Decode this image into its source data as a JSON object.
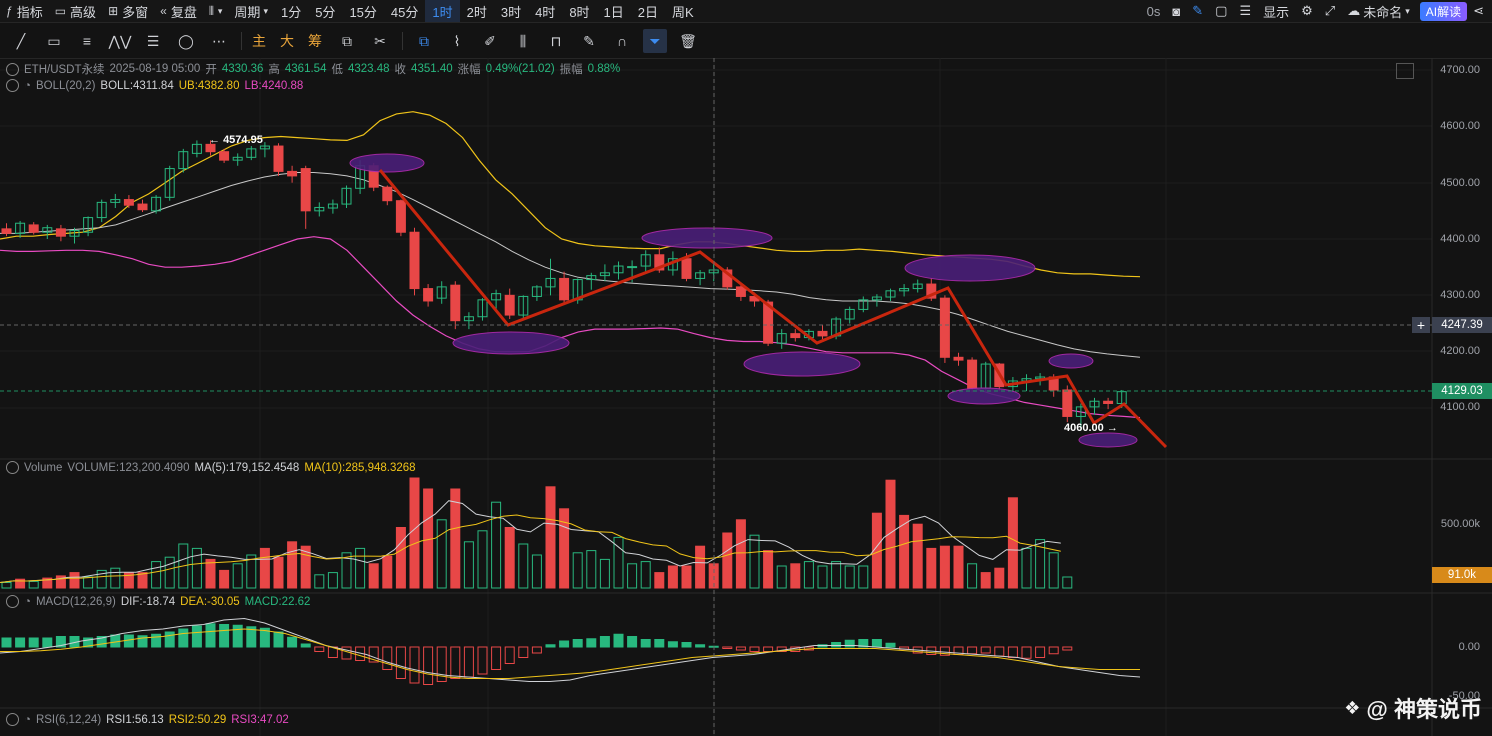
{
  "topbar": {
    "indicators": "指标",
    "advanced": "高级",
    "multi_window": "多窗",
    "replay": "复盘",
    "period": "周期",
    "timeframes": [
      "1分",
      "5分",
      "15分",
      "45分",
      "1时",
      "2时",
      "3时",
      "4时",
      "8时",
      "1日",
      "2日",
      "周K"
    ],
    "active_timeframe": "1时",
    "countdown": "0s",
    "display": "显示",
    "unnamed": "未命名",
    "ai_label": "AI解读"
  },
  "toolbar": {
    "main": "主",
    "big": "大",
    "chips": "筹"
  },
  "legend": {
    "symbol": "ETH/USDT永续",
    "datetime": "2025-08-19 05:00",
    "open_label": "开",
    "open": "4330.36",
    "high_label": "高",
    "high": "4361.54",
    "low_label": "低",
    "low": "4323.48",
    "close_label": "收",
    "close": "4351.40",
    "change_label": "涨幅",
    "change": "0.49%(21.02)",
    "amp_label": "振幅",
    "amp": "0.88%",
    "boll_name": "BOLL(20,2)",
    "boll": "BOLL:4311.84",
    "ub": "UB:4382.80",
    "lb": "LB:4240.88",
    "vol_name": "Volume",
    "volume": "VOLUME:123,200.4090",
    "ma5": "MA(5):179,152.4548",
    "ma10": "MA(10):285,948.3268",
    "macd_name": "MACD(12,26,9)",
    "dif": "DIF:-18.74",
    "dea": "DEA:-30.05",
    "macd": "MACD:22.62",
    "rsi_name": "RSI(6,12,24)",
    "rsi1": "RSI1:56.13",
    "rsi2": "RSI2:50.29",
    "rsi3": "RSI3:47.02"
  },
  "axis": {
    "price_ticks": [
      "4700.00",
      "4600.00",
      "4500.00",
      "4400.00",
      "4300.00",
      "4200.00",
      "4100.00"
    ],
    "cursor_price": "4247.39",
    "last_price": "4129.03",
    "volume_tick": "500.00k",
    "volume_last": "91.0k",
    "macd_tick_zero": "0.00",
    "macd_tick_low": "-50.00"
  },
  "annotations": {
    "high_label": "4574.95",
    "low_label": "4060.00"
  },
  "watermark": "@ 神策说币",
  "colors": {
    "up": "#28b87f",
    "down": "#e84747",
    "ub": "#f0c419",
    "mid": "#c8c8c8",
    "lb": "#e84bc2",
    "trend": "#c8260e",
    "ellipse": "#4a1f78"
  },
  "chart_data": {
    "type": "candlestick",
    "price_range": [
      4040,
      4720
    ],
    "candles_ohlc": [
      [
        4418,
        4428,
        4405,
        4410
      ],
      [
        4410,
        4432,
        4402,
        4428
      ],
      [
        4425,
        4430,
        4408,
        4412
      ],
      [
        4412,
        4425,
        4400,
        4420
      ],
      [
        4418,
        4425,
        4396,
        4405
      ],
      [
        4405,
        4420,
        4392,
        4415
      ],
      [
        4412,
        4440,
        4405,
        4438
      ],
      [
        4438,
        4470,
        4430,
        4465
      ],
      [
        4465,
        4480,
        4455,
        4470
      ],
      [
        4470,
        4478,
        4455,
        4460
      ],
      [
        4462,
        4470,
        4448,
        4452
      ],
      [
        4450,
        4478,
        4445,
        4474
      ],
      [
        4474,
        4530,
        4468,
        4525
      ],
      [
        4525,
        4560,
        4518,
        4555
      ],
      [
        4552,
        4575,
        4545,
        4568
      ],
      [
        4568,
        4575,
        4548,
        4555
      ],
      [
        4555,
        4560,
        4535,
        4540
      ],
      [
        4540,
        4552,
        4530,
        4545
      ],
      [
        4545,
        4565,
        4540,
        4560
      ],
      [
        4560,
        4572,
        4545,
        4565
      ],
      [
        4565,
        4570,
        4512,
        4520
      ],
      [
        4520,
        4530,
        4500,
        4512
      ],
      [
        4525,
        4530,
        4418,
        4450
      ],
      [
        4450,
        4465,
        4440,
        4456
      ],
      [
        4455,
        4470,
        4445,
        4462
      ],
      [
        4462,
        4495,
        4455,
        4490
      ],
      [
        4490,
        4540,
        4480,
        4530
      ],
      [
        4530,
        4535,
        4485,
        4492
      ],
      [
        4492,
        4495,
        4460,
        4468
      ],
      [
        4468,
        4470,
        4405,
        4412
      ],
      [
        4412,
        4420,
        4300,
        4312
      ],
      [
        4312,
        4320,
        4280,
        4290
      ],
      [
        4295,
        4325,
        4285,
        4315
      ],
      [
        4318,
        4325,
        4240,
        4255
      ],
      [
        4255,
        4270,
        4240,
        4262
      ],
      [
        4262,
        4295,
        4255,
        4292
      ],
      [
        4292,
        4310,
        4275,
        4303
      ],
      [
        4300,
        4312,
        4258,
        4265
      ],
      [
        4265,
        4300,
        4258,
        4298
      ],
      [
        4298,
        4318,
        4290,
        4315
      ],
      [
        4315,
        4365,
        4300,
        4330
      ],
      [
        4330,
        4342,
        4285,
        4292
      ],
      [
        4292,
        4330,
        4285,
        4328
      ],
      [
        4328,
        4340,
        4310,
        4335
      ],
      [
        4335,
        4355,
        4325,
        4340
      ],
      [
        4340,
        4360,
        4328,
        4352
      ],
      [
        4351,
        4362,
        4323,
        4351
      ],
      [
        4352,
        4380,
        4340,
        4372
      ],
      [
        4372,
        4385,
        4340,
        4345
      ],
      [
        4345,
        4378,
        4335,
        4365
      ],
      [
        4365,
        4375,
        4325,
        4330
      ],
      [
        4330,
        4345,
        4318,
        4340
      ],
      [
        4340,
        4360,
        4325,
        4345
      ],
      [
        4345,
        4350,
        4310,
        4315
      ],
      [
        4315,
        4320,
        4290,
        4298
      ],
      [
        4298,
        4305,
        4280,
        4290
      ],
      [
        4288,
        4292,
        4210,
        4215
      ],
      [
        4215,
        4240,
        4205,
        4232
      ],
      [
        4232,
        4240,
        4218,
        4225
      ],
      [
        4225,
        4240,
        4220,
        4236
      ],
      [
        4236,
        4248,
        4222,
        4228
      ],
      [
        4228,
        4262,
        4222,
        4258
      ],
      [
        4258,
        4280,
        4250,
        4275
      ],
      [
        4275,
        4298,
        4270,
        4292
      ],
      [
        4292,
        4302,
        4280,
        4297
      ],
      [
        4297,
        4312,
        4290,
        4308
      ],
      [
        4308,
        4320,
        4298,
        4312
      ],
      [
        4312,
        4328,
        4305,
        4320
      ],
      [
        4320,
        4330,
        4290,
        4295
      ],
      [
        4295,
        4300,
        4180,
        4190
      ],
      [
        4190,
        4198,
        4175,
        4185
      ],
      [
        4185,
        4190,
        4128,
        4135
      ],
      [
        4135,
        4182,
        4128,
        4178
      ],
      [
        4178,
        4180,
        4130,
        4138
      ],
      [
        4138,
        4155,
        4128,
        4148
      ],
      [
        4148,
        4160,
        4130,
        4152
      ],
      [
        4152,
        4162,
        4140,
        4155
      ],
      [
        4155,
        4160,
        4120,
        4132
      ],
      [
        4132,
        4140,
        4075,
        4085
      ],
      [
        4085,
        4108,
        4060,
        4102
      ],
      [
        4102,
        4118,
        4088,
        4112
      ],
      [
        4112,
        4118,
        4098,
        4108
      ],
      [
        4108,
        4132,
        4100,
        4129
      ]
    ],
    "boll_ub": [
      4400,
      4405,
      4405,
      4408,
      4410,
      4412,
      4420,
      4440,
      4465,
      4480,
      4500,
      4520,
      4535,
      4550,
      4565,
      4575,
      4580,
      4582,
      4580,
      4578,
      4576,
      4575,
      4585,
      4610,
      4622,
      4626,
      4620,
      4605,
      4580,
      4540,
      4505,
      4480,
      4450,
      4420,
      4400,
      4392,
      4388,
      4386,
      4384,
      4383,
      4383,
      4390,
      4395,
      4395,
      4392,
      4388,
      4384,
      4380,
      4378,
      4378,
      4380,
      4380,
      4382,
      4380,
      4378,
      4375,
      4372,
      4370,
      4368,
      4366,
      4364,
      4360,
      4352,
      4345,
      4340,
      4338,
      4338,
      4336,
      4334,
      4333
    ],
    "boll_mid": [
      4410,
      4410,
      4412,
      4414,
      4416,
      4418,
      4420,
      4425,
      4435,
      4445,
      4455,
      4465,
      4475,
      4485,
      4495,
      4503,
      4510,
      4515,
      4518,
      4518,
      4516,
      4512,
      4505,
      4495,
      4484,
      4470,
      4455,
      4440,
      4425,
      4410,
      4395,
      4378,
      4363,
      4350,
      4340,
      4332,
      4328,
      4325,
      4322,
      4320,
      4318,
      4316,
      4314,
      4312,
      4311,
      4310,
      4308,
      4306,
      4302,
      4296,
      4292,
      4290,
      4290,
      4290,
      4288,
      4285,
      4280,
      4274,
      4266,
      4256,
      4246,
      4236,
      4228,
      4220,
      4212,
      4205,
      4200,
      4196,
      4193,
      4190
    ],
    "boll_lb": [
      4380,
      4378,
      4378,
      4379,
      4380,
      4380,
      4378,
      4372,
      4365,
      4355,
      4350,
      4350,
      4352,
      4355,
      4360,
      4370,
      4380,
      4390,
      4400,
      4404,
      4400,
      4380,
      4350,
      4320,
      4290,
      4265,
      4245,
      4228,
      4215,
      4205,
      4200,
      4200,
      4200,
      4210,
      4225,
      4235,
      4240,
      4240,
      4240,
      4241,
      4242,
      4240,
      4232,
      4225,
      4220,
      4218,
      4218,
      4216,
      4212,
      4206,
      4200,
      4198,
      4198,
      4198,
      4198,
      4194,
      4185,
      4165,
      4150,
      4135,
      4125,
      4118,
      4110,
      4105,
      4100,
      4095,
      4090,
      4087,
      4085,
      4083
    ],
    "volume": [
      {
        "v": 0.05,
        "up": 1
      },
      {
        "v": 0.08,
        "up": 0
      },
      {
        "v": 0.06,
        "up": 1
      },
      {
        "v": 0.09,
        "up": 0
      },
      {
        "v": 0.11,
        "up": 0
      },
      {
        "v": 0.14,
        "up": 0
      },
      {
        "v": 0.1,
        "up": 1
      },
      {
        "v": 0.16,
        "up": 1
      },
      {
        "v": 0.18,
        "up": 1
      },
      {
        "v": 0.14,
        "up": 0
      },
      {
        "v": 0.14,
        "up": 0
      },
      {
        "v": 0.24,
        "up": 1
      },
      {
        "v": 0.28,
        "up": 1
      },
      {
        "v": 0.4,
        "up": 1
      },
      {
        "v": 0.36,
        "up": 1
      },
      {
        "v": 0.26,
        "up": 0
      },
      {
        "v": 0.16,
        "up": 0
      },
      {
        "v": 0.22,
        "up": 1
      },
      {
        "v": 0.3,
        "up": 1
      },
      {
        "v": 0.36,
        "up": 0
      },
      {
        "v": 0.28,
        "up": 0
      },
      {
        "v": 0.42,
        "up": 0
      },
      {
        "v": 0.38,
        "up": 0
      },
      {
        "v": 0.12,
        "up": 1
      },
      {
        "v": 0.14,
        "up": 1
      },
      {
        "v": 0.32,
        "up": 1
      },
      {
        "v": 0.36,
        "up": 1
      },
      {
        "v": 0.22,
        "up": 0
      },
      {
        "v": 0.29,
        "up": 0
      },
      {
        "v": 0.55,
        "up": 0
      },
      {
        "v": 1.0,
        "up": 0
      },
      {
        "v": 0.9,
        "up": 0
      },
      {
        "v": 0.62,
        "up": 1
      },
      {
        "v": 0.9,
        "up": 0
      },
      {
        "v": 0.42,
        "up": 1
      },
      {
        "v": 0.52,
        "up": 1
      },
      {
        "v": 0.78,
        "up": 1
      },
      {
        "v": 0.55,
        "up": 0
      },
      {
        "v": 0.4,
        "up": 1
      },
      {
        "v": 0.3,
        "up": 1
      },
      {
        "v": 0.92,
        "up": 0
      },
      {
        "v": 0.72,
        "up": 0
      },
      {
        "v": 0.32,
        "up": 1
      },
      {
        "v": 0.34,
        "up": 1
      },
      {
        "v": 0.26,
        "up": 1
      },
      {
        "v": 0.46,
        "up": 1
      },
      {
        "v": 0.22,
        "up": 1
      },
      {
        "v": 0.24,
        "up": 1
      },
      {
        "v": 0.14,
        "up": 0
      },
      {
        "v": 0.2,
        "up": 0
      },
      {
        "v": 0.2,
        "up": 0
      },
      {
        "v": 0.38,
        "up": 0
      },
      {
        "v": 0.22,
        "up": 0
      },
      {
        "v": 0.5,
        "up": 0
      },
      {
        "v": 0.62,
        "up": 0
      },
      {
        "v": 0.48,
        "up": 1
      },
      {
        "v": 0.34,
        "up": 0
      },
      {
        "v": 0.2,
        "up": 1
      },
      {
        "v": 0.22,
        "up": 0
      },
      {
        "v": 0.24,
        "up": 1
      },
      {
        "v": 0.2,
        "up": 1
      },
      {
        "v": 0.24,
        "up": 1
      },
      {
        "v": 0.2,
        "up": 1
      },
      {
        "v": 0.2,
        "up": 1
      },
      {
        "v": 0.68,
        "up": 0
      },
      {
        "v": 0.98,
        "up": 0
      },
      {
        "v": 0.66,
        "up": 0
      },
      {
        "v": 0.58,
        "up": 0
      },
      {
        "v": 0.36,
        "up": 0
      },
      {
        "v": 0.38,
        "up": 0
      },
      {
        "v": 0.38,
        "up": 0
      },
      {
        "v": 0.22,
        "up": 1
      },
      {
        "v": 0.14,
        "up": 0
      },
      {
        "v": 0.18,
        "up": 0
      },
      {
        "v": 0.82,
        "up": 0
      },
      {
        "v": 0.36,
        "up": 1
      },
      {
        "v": 0.44,
        "up": 1
      },
      {
        "v": 0.32,
        "up": 1
      },
      {
        "v": 0.1,
        "up": 1
      }
    ],
    "macd_hist": [
      12,
      12,
      12,
      12,
      14,
      14,
      12,
      14,
      16,
      16,
      15,
      17,
      20,
      24,
      28,
      31,
      30,
      29,
      27,
      25,
      20,
      13,
      4,
      -6,
      -14,
      -16,
      -18,
      -20,
      -30,
      -42,
      -48,
      -50,
      -46,
      -42,
      -40,
      -36,
      -30,
      -22,
      -14,
      -8,
      3,
      8,
      10,
      11,
      14,
      17,
      14,
      10,
      10,
      7,
      6,
      3,
      1,
      -2,
      -4,
      -6,
      -6,
      -6,
      -6,
      -4,
      3,
      6,
      9,
      10,
      10,
      5,
      -3,
      -8,
      -10,
      -11,
      -10,
      -9,
      -8,
      -12,
      -14,
      -15,
      -14,
      -9,
      -4
    ],
    "macd_dif": [
      -8,
      -6,
      -2,
      2,
      8,
      12,
      18,
      22,
      24,
      28,
      30,
      36,
      38,
      32,
      22,
      12,
      2,
      -4,
      -10,
      -20,
      -28,
      -34,
      -38,
      -40,
      -42,
      -44,
      -46,
      -46,
      -44,
      -38,
      -34,
      -30,
      -26,
      -22,
      -18,
      -14,
      -12,
      -10,
      -6,
      -2,
      2,
      2,
      2,
      0,
      -2,
      -4,
      -6,
      -8,
      -10,
      -12,
      -14,
      -20,
      -26,
      -30,
      -34,
      -38,
      -40
    ],
    "macd_dea": [
      -6,
      -6,
      -5,
      -3,
      0,
      4,
      8,
      12,
      14,
      18,
      20,
      22,
      24,
      22,
      18,
      10,
      2,
      -6,
      -14,
      -22,
      -30,
      -36,
      -40,
      -42,
      -42,
      -42,
      -40,
      -38,
      -36,
      -34,
      -30,
      -26,
      -22,
      -18,
      -14,
      -12,
      -10,
      -8,
      -6,
      -4,
      -2,
      -2,
      -2,
      -2,
      -4,
      -6,
      -8,
      -10,
      -12,
      -14,
      -18,
      -22,
      -26,
      -28,
      -30,
      -30,
      -30
    ]
  }
}
